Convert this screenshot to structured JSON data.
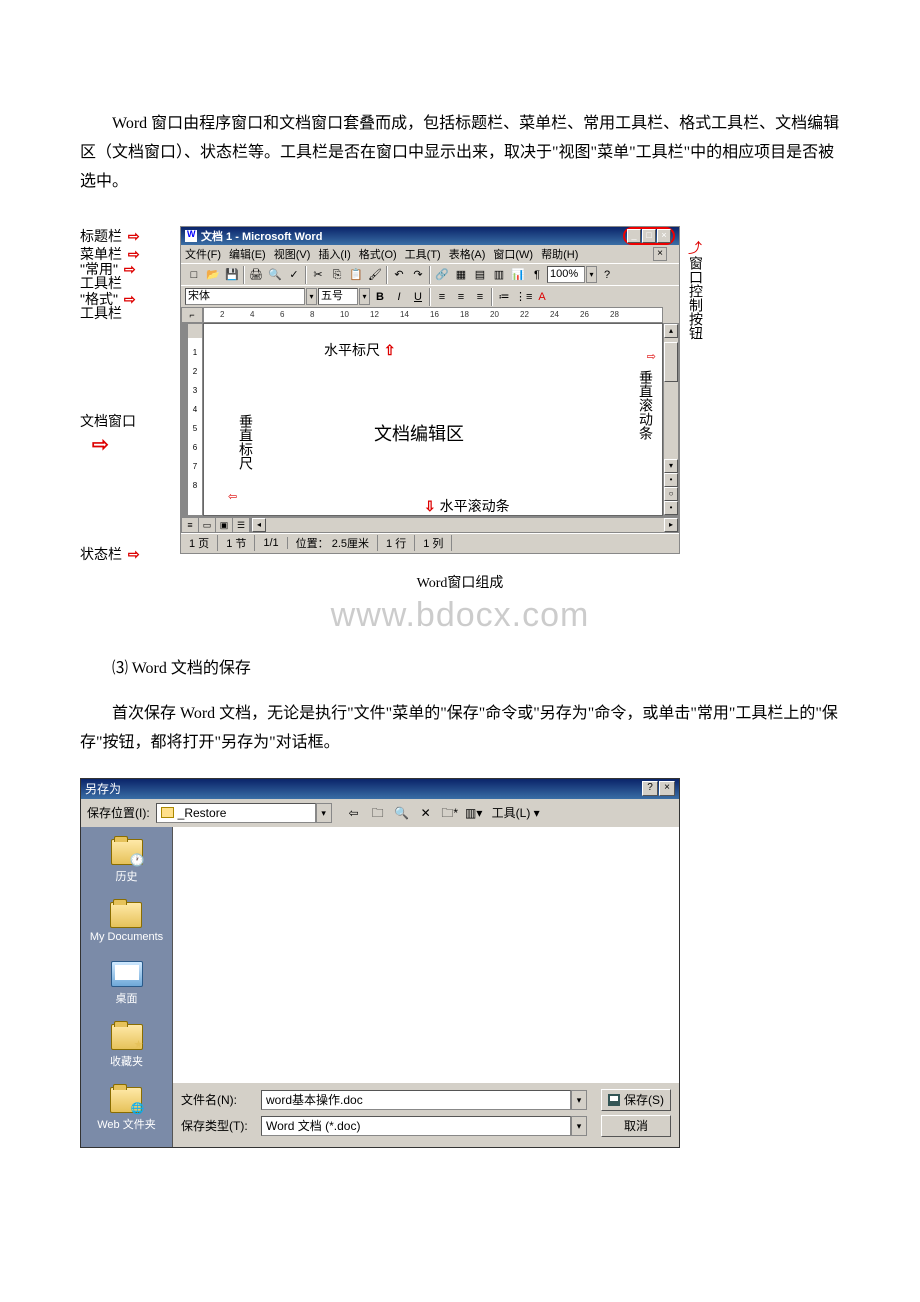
{
  "para1": "Word 窗口由程序窗口和文档窗口套叠而成，包括标题栏、菜单栏、常用工具栏、格式工具栏、文档编辑区（文档窗口）、状态栏等。工具栏是否在窗口中显示出来，取决于\"视图\"菜单\"工具栏\"中的相应项目是否被选中。",
  "labels": {
    "titlebar": "标题栏",
    "menubar": "菜单栏",
    "stdToolbar1": "\"常用\"",
    "stdToolbar2": "工具栏",
    "fmtToolbar1": "\"格式\"",
    "fmtToolbar2": "工具栏",
    "docWindow": "文档窗口",
    "statusbar": "状态栏",
    "winCtrlBtn": "窗口控制按钮",
    "hRuler": "水平标尺",
    "vRuler": "垂直标尺",
    "docEdit": "文档编辑区",
    "vScroll": "垂直滚动条",
    "hScroll": "水平滚动条"
  },
  "wordWin": {
    "title": "文档 1 - Microsoft Word",
    "menus": [
      "文件(F)",
      "编辑(E)",
      "视图(V)",
      "插入(I)",
      "格式(O)",
      "工具(T)",
      "表格(A)",
      "窗口(W)",
      "帮助(H)"
    ],
    "zoom": "100%",
    "font": "宋体",
    "fontSize": "五号",
    "rulerMarks": [
      "2",
      "4",
      "6",
      "8",
      "10",
      "12",
      "14",
      "16",
      "18",
      "20",
      "22",
      "24",
      "26",
      "28"
    ],
    "vRulerMarks": [
      "1",
      "2",
      "3",
      "4",
      "5",
      "6",
      "7",
      "8"
    ],
    "status": {
      "page": "1 页",
      "sec": "1 节",
      "pg": "1/1",
      "pos": "位置：  2.5厘米",
      "line": "1 行",
      "col": "1 列"
    }
  },
  "fig1Caption": "Word窗口组成",
  "watermark": "www.bdocx.com",
  "sec3": "⑶ Word 文档的保存",
  "para2": "首次保存 Word 文档，无论是执行\"文件\"菜单的\"保存\"命令或\"另存为\"命令，或单击\"常用\"工具栏上的\"保存\"按钮，都将打开\"另存为\"对话框。",
  "saveAs": {
    "title": "另存为",
    "locationLabel": "保存位置(I):",
    "locationValue": "_Restore",
    "toolsLabel": "工具(L)",
    "side": [
      "历史",
      "My Documents",
      "桌面",
      "收藏夹",
      "Web 文件夹"
    ],
    "fileNameLabel": "文件名(N):",
    "fileNameValue": "word基本操作.doc",
    "fileTypeLabel": "保存类型(T):",
    "fileTypeValue": "Word 文档 (*.doc)",
    "saveBtn": "保存(S)",
    "cancelBtn": "取消"
  }
}
